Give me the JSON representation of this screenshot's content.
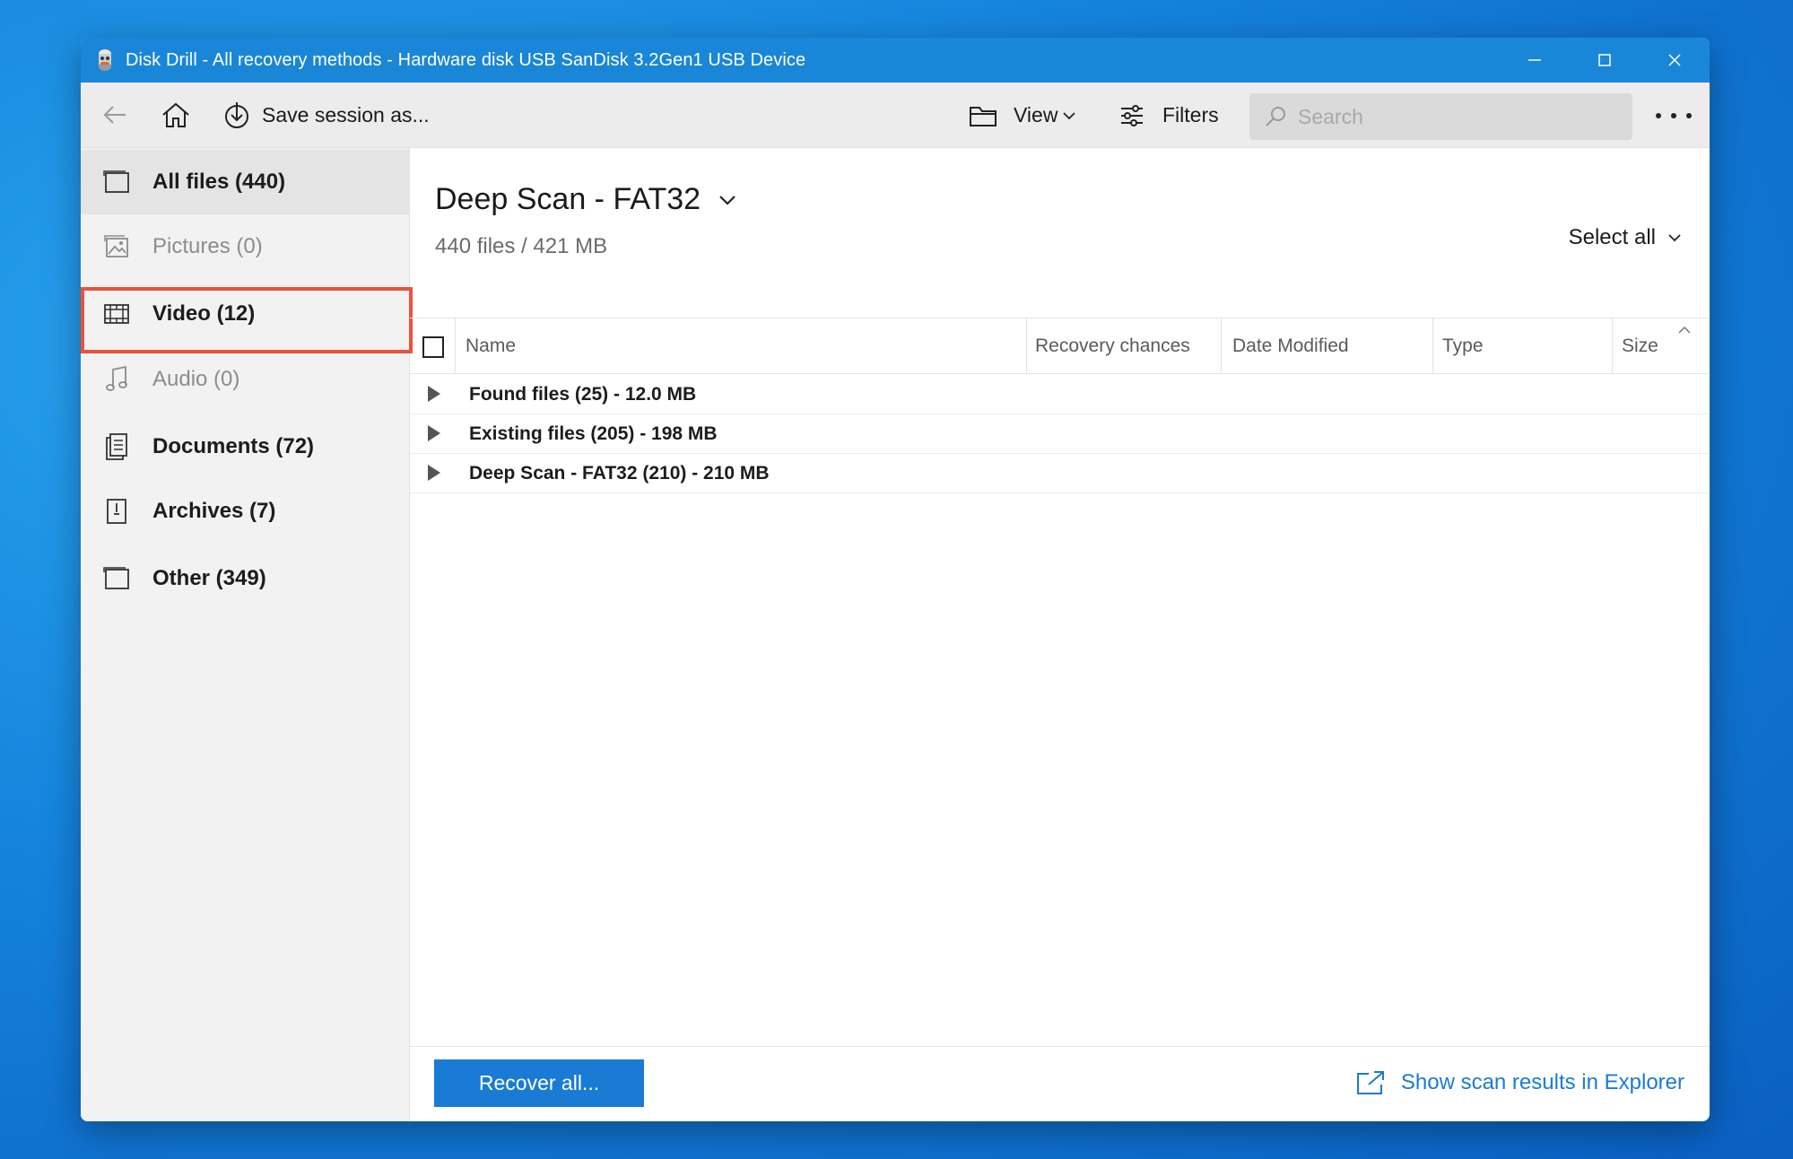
{
  "window": {
    "title": "Disk Drill - All recovery methods - Hardware disk USB  SanDisk 3.2Gen1 USB Device"
  },
  "toolbar": {
    "save_label": "Save session as...",
    "view_label": "View",
    "filters_label": "Filters",
    "search_placeholder": "Search"
  },
  "sidebar": {
    "items": [
      {
        "label": "All files (440)",
        "icon": "all-files-icon",
        "active": true
      },
      {
        "label": "Pictures (0)",
        "icon": "picture-icon",
        "dim": true
      },
      {
        "label": "Video (12)",
        "icon": "film-icon",
        "highlighted": true
      },
      {
        "label": "Audio (0)",
        "icon": "music-note-icon",
        "dim": true
      },
      {
        "label": "Documents (72)",
        "icon": "documents-icon"
      },
      {
        "label": "Archives (7)",
        "icon": "archive-icon"
      },
      {
        "label": "Other (349)",
        "icon": "other-files-icon"
      }
    ]
  },
  "main": {
    "scan_title": "Deep Scan - FAT32",
    "scan_summary": "440 files / 421 MB",
    "select_all": "Select all",
    "columns": [
      "Name",
      "Recovery chances",
      "Date Modified",
      "Type",
      "Size"
    ],
    "rows": [
      "Found files (25) - 12.0 MB",
      "Existing files (205) - 198 MB",
      "Deep Scan - FAT32 (210) - 210 MB"
    ]
  },
  "footer": {
    "recover_label": "Recover all...",
    "explorer_label": "Show scan results in Explorer"
  },
  "colors": {
    "titlebar": "#1a86d8",
    "accent": "#1a7bd4",
    "highlight_border": "#e8533f"
  }
}
